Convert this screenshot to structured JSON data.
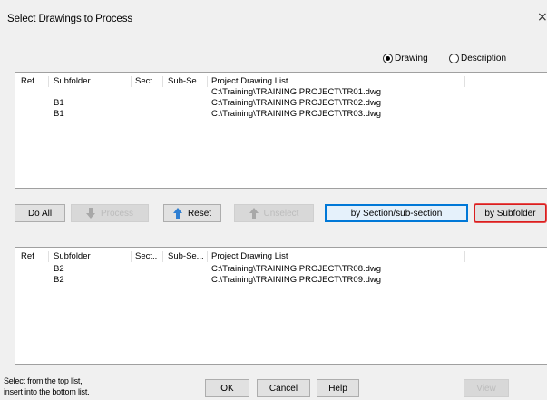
{
  "dialog": {
    "title": "Select Drawings to Process",
    "close_glyph": "×"
  },
  "view_mode": {
    "options": [
      {
        "label": "Drawing",
        "selected": true
      },
      {
        "label": "Description",
        "selected": false
      }
    ]
  },
  "top_list": {
    "columns": [
      "Ref",
      "Subfolder",
      "Sect..",
      "Sub-Se...",
      "Project Drawing List"
    ],
    "rows": [
      {
        "ref": "",
        "subfolder": "",
        "section": "",
        "subsection": "",
        "path": "C:\\Training\\TRAINING PROJECT\\TR01.dwg"
      },
      {
        "ref": "",
        "subfolder": "B1",
        "section": "",
        "subsection": "",
        "path": "C:\\Training\\TRAINING PROJECT\\TR02.dwg"
      },
      {
        "ref": "",
        "subfolder": "B1",
        "section": "",
        "subsection": "",
        "path": "C:\\Training\\TRAINING PROJECT\\TR03.dwg"
      }
    ]
  },
  "toolbar": {
    "do_all": "Do All",
    "process": "Process",
    "reset": "Reset",
    "unselect": "Unselect",
    "by_section": "by Section/sub-section",
    "by_subfolder": "by Subfolder"
  },
  "bottom_list": {
    "columns": [
      "Ref",
      "Subfolder",
      "Sect..",
      "Sub-Se...",
      "Project Drawing List"
    ],
    "rows": [
      {
        "ref": "",
        "subfolder": "B2",
        "section": "",
        "subsection": "",
        "path": "C:\\Training\\TRAINING PROJECT\\TR08.dwg"
      },
      {
        "ref": "",
        "subfolder": "B2",
        "section": "",
        "subsection": "",
        "path": "C:\\Training\\TRAINING PROJECT\\TR09.dwg"
      }
    ]
  },
  "footer": {
    "hint_line1": "Select from the top list,",
    "hint_line2": "insert into the bottom list.",
    "ok": "OK",
    "cancel": "Cancel",
    "help": "Help",
    "view": "View"
  },
  "icons": {
    "arrow_color": "#2f7fd2",
    "disabled_arrow_color": "#a8a8a8"
  }
}
